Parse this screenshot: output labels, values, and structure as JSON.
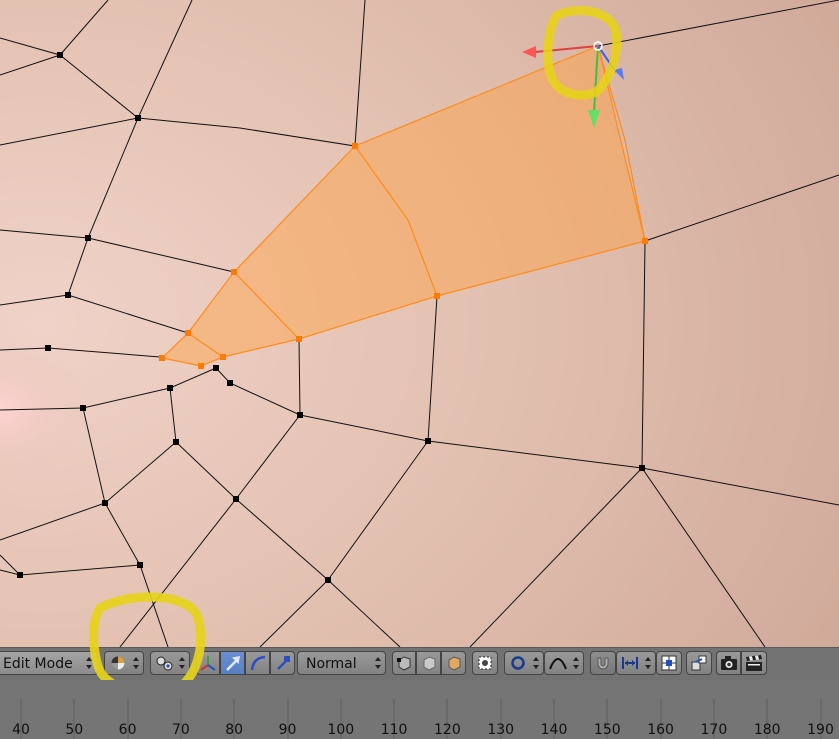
{
  "header": {
    "mode_label": "Edit Mode",
    "pivot_label": "Normal",
    "icons": {
      "viewport_shading": "viewport-shading-icon",
      "pivot_point": "pivot-point-icon",
      "manipulator": "3d-manipulator-icon",
      "translate": "translate-icon",
      "rotate": "rotate-icon",
      "scale": "scale-icon",
      "vertex_select": "vertex-select-icon",
      "edge_select": "edge-select-icon",
      "face_select": "face-select-icon",
      "limit_selection": "limit-selection-icon",
      "proportional_edit": "proportional-edit-icon",
      "falloff": "falloff-icon",
      "snap": "snap-magnet-icon",
      "snap_element": "snap-element-icon",
      "snap_target": "snap-target-icon",
      "retopo": "retopo-icon",
      "render_opengl": "render-still-icon",
      "render_anim": "render-animation-icon"
    }
  },
  "timeline": {
    "ticks": [
      "40",
      "50",
      "60",
      "70",
      "80",
      "90",
      "100",
      "110",
      "120",
      "130",
      "140",
      "150",
      "160",
      "170",
      "180",
      "190"
    ]
  },
  "colors": {
    "skin": "#dcb9a8",
    "selection": "#ffa040",
    "annotation": "#e6d21a",
    "header": "#727272",
    "timeline": "#757575"
  }
}
